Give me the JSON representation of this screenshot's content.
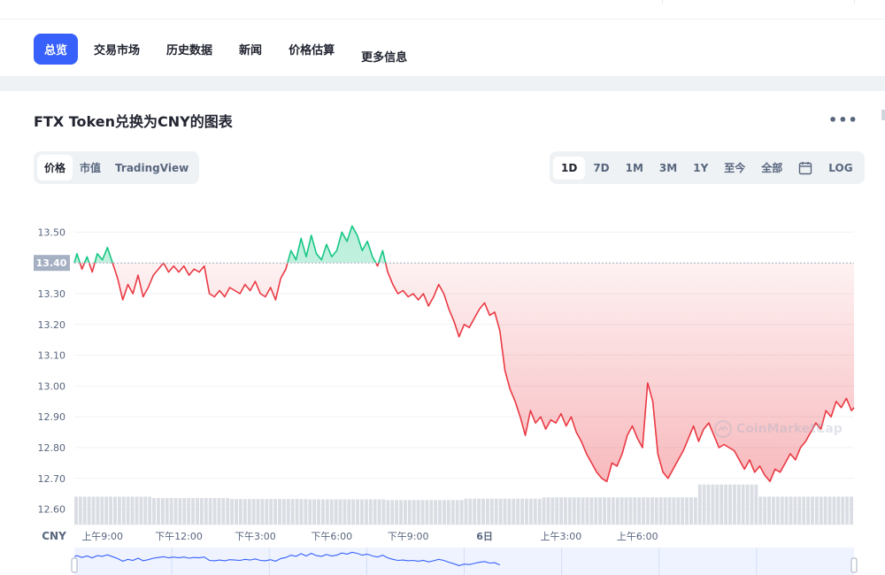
{
  "nav": {
    "tabs": [
      {
        "label": "总览",
        "active": true
      },
      {
        "label": "交易市场",
        "active": false
      },
      {
        "label": "历史数据",
        "active": false
      },
      {
        "label": "新闻",
        "active": false
      },
      {
        "label": "价格估算",
        "active": false
      },
      {
        "label": "更多信息",
        "active": false
      }
    ]
  },
  "chart_header": {
    "title": "FTX Token兑换为CNY的图表",
    "more_icon": "more-horizontal-icon"
  },
  "view_toggle": [
    {
      "label": "价格",
      "active": true
    },
    {
      "label": "市值",
      "active": false
    },
    {
      "label": "TradingView",
      "active": false
    }
  ],
  "range_toggle": [
    {
      "label": "1D",
      "active": true
    },
    {
      "label": "7D",
      "active": false
    },
    {
      "label": "1M",
      "active": false
    },
    {
      "label": "3M",
      "active": false
    },
    {
      "label": "1Y",
      "active": false
    },
    {
      "label": "至今",
      "active": false
    },
    {
      "label": "全部",
      "active": false
    },
    {
      "label": "",
      "icon": "calendar-icon",
      "active": false
    },
    {
      "label": "LOG",
      "active": false
    }
  ],
  "colors": {
    "accent": "#3861fb",
    "up": "#16c784",
    "down": "#ea3943",
    "volume": "#dadee4",
    "navigator": "#3861fb"
  },
  "watermark": "CoinMarketCap",
  "chart_data": {
    "type": "line",
    "currency_label": "CNY",
    "ylim": [
      12.55,
      13.55
    ],
    "yticks": [
      13.5,
      13.3,
      13.2,
      13.1,
      13.0,
      12.9,
      12.8,
      12.7,
      12.6
    ],
    "reference_value": 13.4,
    "reference_label": "13.40",
    "xticks": [
      "上午9:00",
      "下午12:00",
      "下午3:00",
      "下午6:00",
      "下午9:00",
      "6日",
      "上午3:00",
      "上午6:00"
    ],
    "x_hours": [
      0,
      10,
      13,
      16,
      19,
      22,
      24,
      27,
      30,
      32.5
    ],
    "series": [
      {
        "values": [
          [
            7.9,
            13.4
          ],
          [
            8.0,
            13.43
          ],
          [
            8.2,
            13.38
          ],
          [
            8.4,
            13.42
          ],
          [
            8.6,
            13.37
          ],
          [
            8.8,
            13.43
          ],
          [
            9.0,
            13.41
          ],
          [
            9.2,
            13.45
          ],
          [
            9.4,
            13.4
          ],
          [
            9.6,
            13.35
          ],
          [
            9.8,
            13.28
          ],
          [
            10.0,
            13.33
          ],
          [
            10.2,
            13.3
          ],
          [
            10.4,
            13.36
          ],
          [
            10.6,
            13.29
          ],
          [
            10.8,
            13.32
          ],
          [
            11.0,
            13.36
          ],
          [
            11.2,
            13.38
          ],
          [
            11.4,
            13.4
          ],
          [
            11.6,
            13.37
          ],
          [
            11.8,
            13.39
          ],
          [
            12.0,
            13.37
          ],
          [
            12.2,
            13.39
          ],
          [
            12.4,
            13.36
          ],
          [
            12.6,
            13.38
          ],
          [
            12.8,
            13.37
          ],
          [
            13.0,
            13.39
          ],
          [
            13.2,
            13.3
          ],
          [
            13.4,
            13.29
          ],
          [
            13.6,
            13.31
          ],
          [
            13.8,
            13.29
          ],
          [
            14.0,
            13.32
          ],
          [
            14.2,
            13.31
          ],
          [
            14.4,
            13.3
          ],
          [
            14.6,
            13.33
          ],
          [
            14.8,
            13.31
          ],
          [
            15.0,
            13.34
          ],
          [
            15.2,
            13.3
          ],
          [
            15.4,
            13.29
          ],
          [
            15.6,
            13.32
          ],
          [
            15.8,
            13.28
          ],
          [
            16.0,
            13.35
          ],
          [
            16.2,
            13.38
          ],
          [
            16.4,
            13.44
          ],
          [
            16.6,
            13.41
          ],
          [
            16.8,
            13.48
          ],
          [
            17.0,
            13.42
          ],
          [
            17.2,
            13.49
          ],
          [
            17.4,
            13.43
          ],
          [
            17.6,
            13.41
          ],
          [
            17.8,
            13.46
          ],
          [
            18.0,
            13.42
          ],
          [
            18.2,
            13.44
          ],
          [
            18.4,
            13.5
          ],
          [
            18.6,
            13.47
          ],
          [
            18.8,
            13.52
          ],
          [
            19.0,
            13.49
          ],
          [
            19.2,
            13.44
          ],
          [
            19.4,
            13.47
          ],
          [
            19.6,
            13.42
          ],
          [
            19.8,
            13.39
          ],
          [
            20.0,
            13.44
          ],
          [
            20.2,
            13.37
          ],
          [
            20.4,
            13.33
          ],
          [
            20.6,
            13.3
          ],
          [
            20.8,
            13.31
          ],
          [
            21.0,
            13.29
          ],
          [
            21.2,
            13.3
          ],
          [
            21.4,
            13.28
          ],
          [
            21.6,
            13.3
          ],
          [
            21.8,
            13.26
          ],
          [
            22.0,
            13.29
          ],
          [
            22.2,
            13.33
          ],
          [
            22.4,
            13.3
          ],
          [
            22.6,
            13.25
          ],
          [
            22.8,
            13.21
          ],
          [
            23.0,
            13.16
          ],
          [
            23.2,
            13.2
          ],
          [
            23.4,
            13.19
          ],
          [
            23.6,
            13.22
          ],
          [
            23.8,
            13.25
          ],
          [
            24.0,
            13.27
          ],
          [
            24.2,
            13.23
          ],
          [
            24.4,
            13.24
          ],
          [
            24.6,
            13.18
          ],
          [
            24.8,
            13.05
          ],
          [
            25.0,
            12.99
          ],
          [
            25.2,
            12.95
          ],
          [
            25.4,
            12.9
          ],
          [
            25.6,
            12.84
          ],
          [
            25.8,
            12.92
          ],
          [
            26.0,
            12.88
          ],
          [
            26.2,
            12.9
          ],
          [
            26.4,
            12.86
          ],
          [
            26.6,
            12.89
          ],
          [
            26.8,
            12.88
          ],
          [
            27.0,
            12.91
          ],
          [
            27.2,
            12.87
          ],
          [
            27.4,
            12.9
          ],
          [
            27.6,
            12.85
          ],
          [
            27.8,
            12.82
          ],
          [
            28.0,
            12.78
          ],
          [
            28.2,
            12.75
          ],
          [
            28.4,
            12.72
          ],
          [
            28.6,
            12.7
          ],
          [
            28.8,
            12.69
          ],
          [
            29.0,
            12.75
          ],
          [
            29.2,
            12.74
          ],
          [
            29.4,
            12.78
          ],
          [
            29.6,
            12.84
          ],
          [
            29.8,
            12.87
          ],
          [
            30.0,
            12.83
          ],
          [
            30.2,
            12.8
          ],
          [
            30.4,
            13.01
          ],
          [
            30.6,
            12.95
          ],
          [
            30.8,
            12.78
          ],
          [
            31.0,
            12.72
          ],
          [
            31.2,
            12.7
          ],
          [
            31.4,
            12.73
          ],
          [
            31.6,
            12.76
          ],
          [
            31.8,
            12.79
          ],
          [
            32.0,
            12.83
          ],
          [
            32.2,
            12.87
          ],
          [
            32.4,
            12.82
          ],
          [
            32.6,
            12.86
          ],
          [
            32.8,
            12.88
          ],
          [
            33.0,
            12.84
          ],
          [
            33.2,
            12.8
          ],
          [
            33.4,
            12.81
          ],
          [
            33.6,
            12.8
          ],
          [
            33.8,
            12.79
          ],
          [
            34.0,
            12.76
          ],
          [
            34.2,
            12.73
          ],
          [
            34.4,
            12.76
          ],
          [
            34.6,
            12.72
          ],
          [
            34.8,
            12.74
          ],
          [
            35.0,
            12.71
          ],
          [
            35.2,
            12.69
          ],
          [
            35.4,
            12.73
          ],
          [
            35.6,
            12.72
          ],
          [
            35.8,
            12.75
          ],
          [
            36.0,
            12.78
          ],
          [
            36.2,
            12.76
          ],
          [
            36.4,
            12.8
          ],
          [
            36.6,
            12.82
          ],
          [
            36.8,
            12.85
          ],
          [
            37.0,
            12.88
          ],
          [
            37.2,
            12.86
          ],
          [
            37.4,
            12.92
          ],
          [
            37.6,
            12.9
          ],
          [
            37.8,
            12.95
          ],
          [
            38.0,
            12.93
          ],
          [
            38.2,
            12.96
          ],
          [
            38.4,
            12.92
          ],
          [
            38.5,
            12.93
          ]
        ]
      }
    ],
    "volume_levels": [
      0.62,
      0.58,
      0.55,
      0.54,
      0.52,
      0.56,
      0.6,
      0.98,
      0.62,
      0.62
    ]
  }
}
